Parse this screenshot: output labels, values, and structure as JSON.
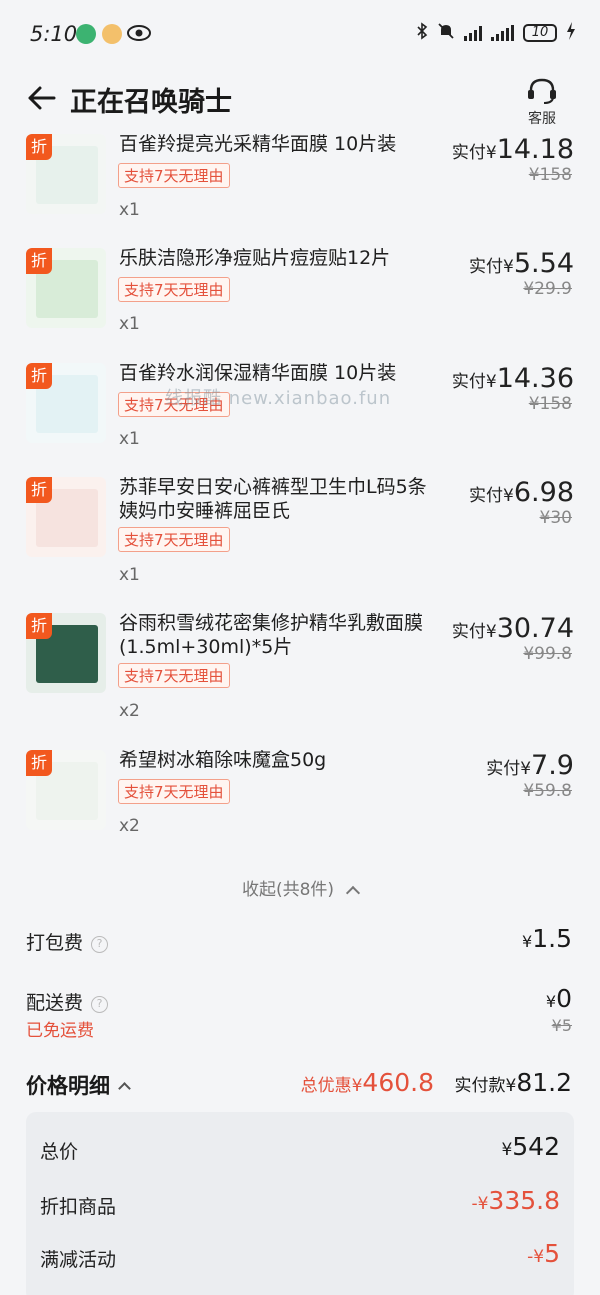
{
  "status_bar": {
    "time": "5:10",
    "battery": "10"
  },
  "header": {
    "title": "正在召唤骑士",
    "service_label": "客服"
  },
  "discount_badge": "折",
  "items": [
    {
      "name": "百雀羚提亮光采精华面膜 10片装",
      "tag": "支持7天无理由",
      "qty": "x1",
      "paid_label": "实付",
      "currency": "¥",
      "price": "14.18",
      "original_price": "¥158",
      "thumb_color": "#e7f1ec"
    },
    {
      "name": "乐肤洁隐形净痘贴片痘痘贴12片",
      "tag": "支持7天无理由",
      "qty": "x1",
      "paid_label": "实付",
      "currency": "¥",
      "price": "5.54",
      "original_price": "¥29.9",
      "thumb_color": "#d8ecd8"
    },
    {
      "name": "百雀羚水润保湿精华面膜 10片装",
      "tag": "支持7天无理由",
      "qty": "x1",
      "paid_label": "实付",
      "currency": "¥",
      "price": "14.36",
      "original_price": "¥158",
      "thumb_color": "#e3f2f4"
    },
    {
      "name": "苏菲早安日安心裤裤型卫生巾L码5条姨妈巾安睡裤屈臣氏",
      "tag": "支持7天无理由",
      "qty": "x1",
      "paid_label": "实付",
      "currency": "¥",
      "price": "6.98",
      "original_price": "¥30",
      "thumb_color": "#f6e3df"
    },
    {
      "name": "谷雨积雪绒花密集修护精华乳敷面膜(1.5ml+30ml)*5片",
      "tag": "支持7天无理由",
      "qty": "x2",
      "paid_label": "实付",
      "currency": "¥",
      "price": "30.74",
      "original_price": "¥99.8",
      "thumb_color": "#2f5e4a"
    },
    {
      "name": "希望树冰箱除味魔盒50g",
      "tag": "支持7天无理由",
      "qty": "x2",
      "paid_label": "实付",
      "currency": "¥",
      "price": "7.9",
      "original_price": "¥59.8",
      "thumb_color": "#eef3ee"
    }
  ],
  "watermark": "线报酷 new.xianbao.fun",
  "collapse_label": "收起(共8件)",
  "fees": {
    "packing_label": "打包费",
    "packing_currency": "¥",
    "packing_amount": "1.5",
    "delivery_label": "配送费",
    "delivery_currency": "¥",
    "delivery_amount": "0",
    "free_shipping": "已免运费",
    "delivery_original": "¥5",
    "help_icon": "?"
  },
  "price_detail": {
    "title": "价格明细",
    "total_discount_label": "总优惠",
    "total_discount_currency": "¥",
    "total_discount": "460.8",
    "actual_label": "实付款",
    "actual_currency": "¥",
    "actual_amount": "81.2",
    "rows": [
      {
        "label": "总价",
        "currency": "¥",
        "value": "542"
      },
      {
        "label": "折扣商品",
        "currency": "-¥",
        "value": "335.8"
      },
      {
        "label": "满减活动",
        "currency": "-¥",
        "value": "5"
      }
    ]
  },
  "colors": {
    "accent_red": "#e4513b",
    "badge_orange": "#f2581e",
    "background": "#f4f5f7"
  }
}
